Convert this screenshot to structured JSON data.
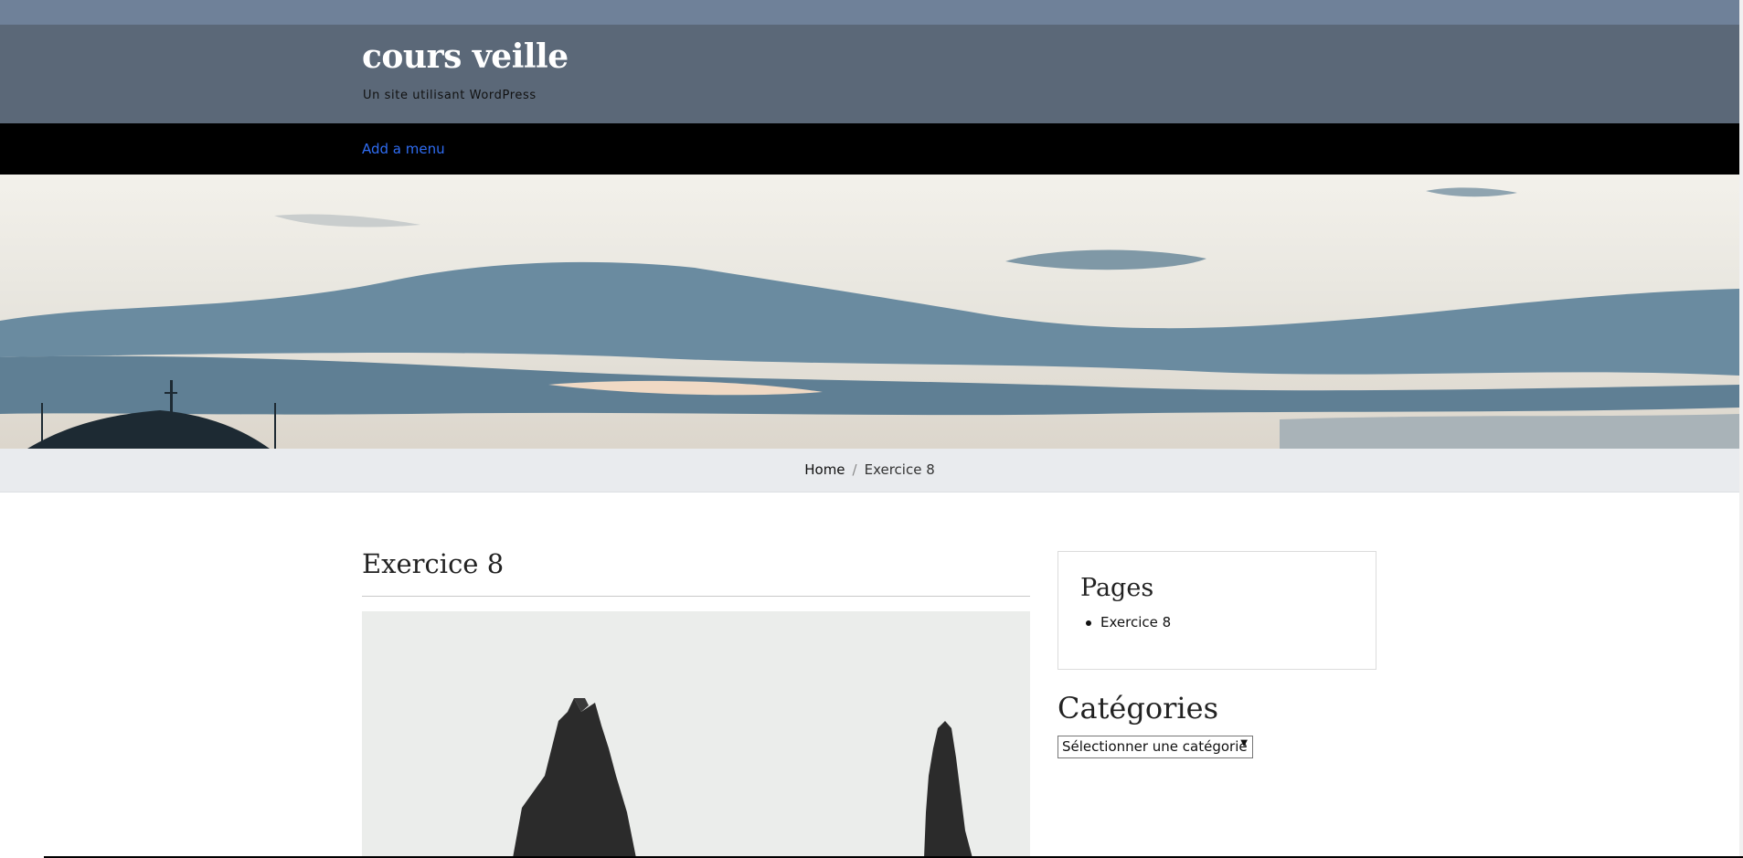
{
  "header": {
    "site_title": "cours veille",
    "site_description": "Un site utilisant WordPress"
  },
  "nav": {
    "add_menu_label": "Add a menu"
  },
  "breadcrumb": {
    "home": "Home",
    "separator": "/",
    "current": "Exercice 8"
  },
  "post": {
    "title": "Exercice 8"
  },
  "sidebar": {
    "pages_widget": {
      "title": "Pages",
      "items": [
        "Exercice 8"
      ]
    },
    "categories_widget": {
      "title": "Catégories",
      "select_value": "Sélectionner une catégorie"
    }
  },
  "colors": {
    "topbar": "#6f8199",
    "header_bg": "#5b6878",
    "nav_bg": "#000000",
    "nav_link": "#2f6cf2",
    "breadcrumb_bg": "#e9ebee"
  }
}
